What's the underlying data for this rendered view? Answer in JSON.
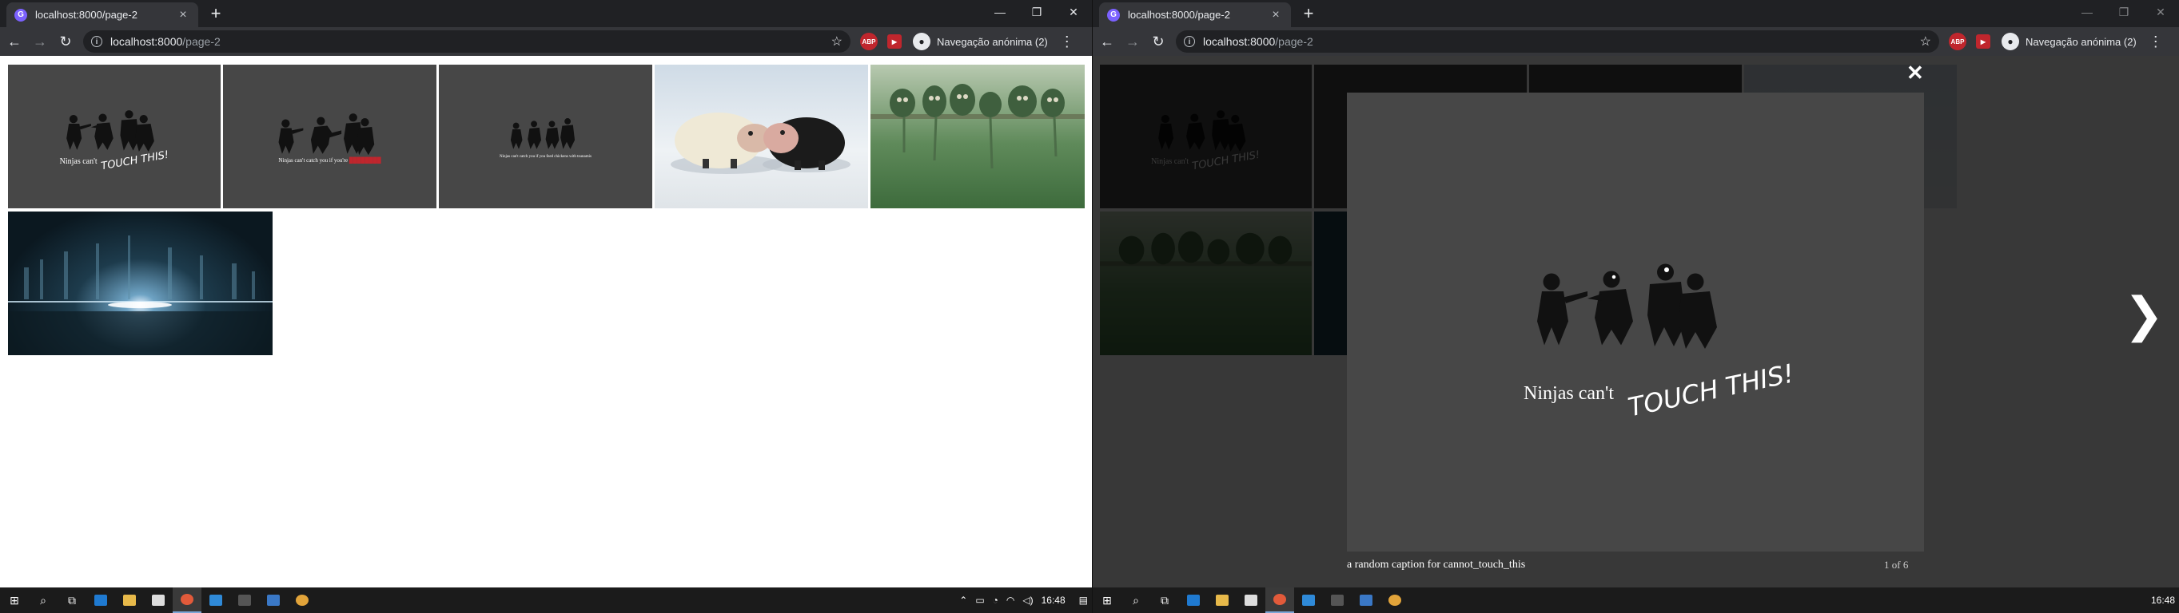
{
  "left_window": {
    "tab": {
      "title": "localhost:8000/page-2",
      "favicon_letter": "G"
    },
    "url": {
      "host": "localhost:8000",
      "path": "/page-2"
    },
    "extensions": [
      "ABP",
      "▶"
    ],
    "profile_label": "Navegação anónima (2)",
    "gallery": {
      "thumbnails": [
        {
          "kind": "ninja",
          "caption_main": "Ninjas can't",
          "caption_scrawl": "TOUCH THIS!"
        },
        {
          "kind": "ninja",
          "caption_main": "Ninjas can't catch you if you're",
          "caption_scrawl": ""
        },
        {
          "kind": "ninja",
          "caption_main": "Ninjas can't catch you if you feed chickens with tsunamis",
          "caption_scrawl": ""
        },
        {
          "kind": "sheep"
        },
        {
          "kind": "creatures"
        },
        {
          "kind": "city"
        }
      ]
    }
  },
  "right_window": {
    "tab": {
      "title": "localhost:8000/page-2",
      "favicon_letter": "G"
    },
    "url": {
      "host": "localhost:8000",
      "path": "/page-2"
    },
    "extensions": [
      "ABP",
      "▶"
    ],
    "profile_label": "Navegação anónima (2)",
    "lightbox": {
      "close_glyph": "✕",
      "next_glyph": "❯",
      "image_caption_main": "Ninjas can't",
      "image_caption_scrawl": "TOUCH THIS!",
      "caption": "a random caption for cannot_touch_this",
      "counter": "1 of 6"
    }
  },
  "taskbar_left": {
    "clock": "16:48"
  },
  "taskbar_right": {
    "clock": "16:48"
  },
  "colors": {
    "accent": "#7b61ff",
    "chrome_dark": "#202124",
    "chrome_mid": "#35363a",
    "ninja_bg": "#474747"
  }
}
